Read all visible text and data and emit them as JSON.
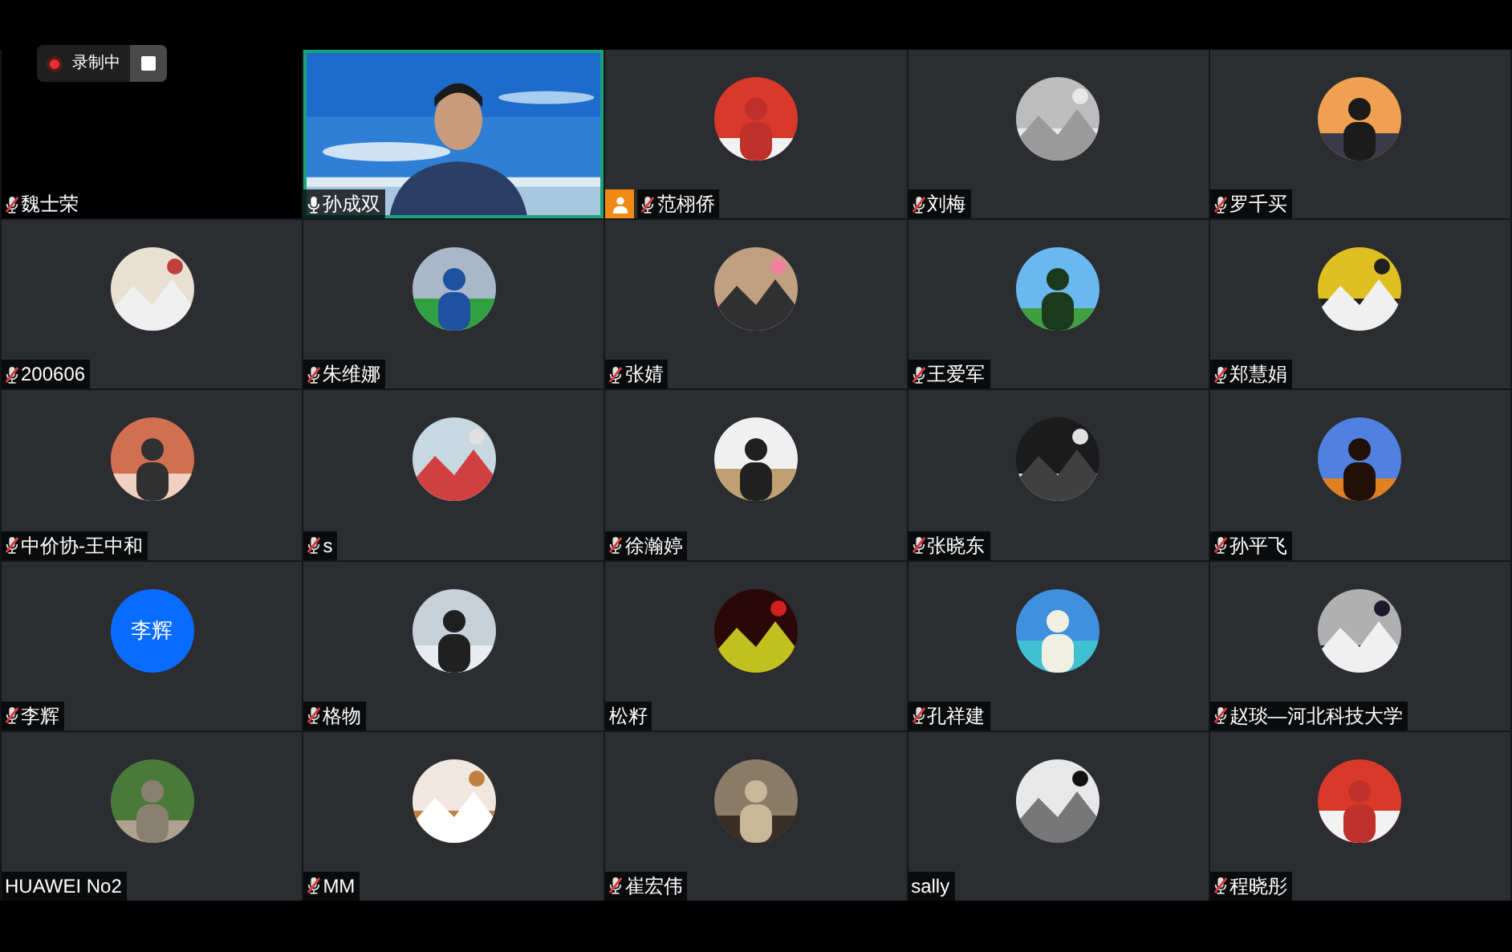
{
  "recording": {
    "label": "录制中"
  },
  "participants": [
    {
      "name": "魏士荣",
      "kind": "blank",
      "mic": {
        "muted": true
      },
      "speaking": false,
      "host": false
    },
    {
      "name": "孙成双",
      "kind": "video",
      "mic": {
        "muted": false
      },
      "speaking": true,
      "host": false
    },
    {
      "name": "范栩侨",
      "kind": "picture",
      "mic": {
        "muted": true
      },
      "speaking": false,
      "host": true
    },
    {
      "name": "刘梅",
      "kind": "picture",
      "mic": {
        "muted": true
      },
      "speaking": false,
      "host": false
    },
    {
      "name": "罗千买",
      "kind": "picture",
      "mic": {
        "muted": true
      },
      "speaking": false,
      "host": false
    },
    {
      "name": "200606",
      "kind": "picture",
      "mic": {
        "muted": true
      },
      "speaking": false,
      "host": false
    },
    {
      "name": "朱维娜",
      "kind": "picture",
      "mic": {
        "muted": true
      },
      "speaking": false,
      "host": false
    },
    {
      "name": "张婧",
      "kind": "picture",
      "mic": {
        "muted": true
      },
      "speaking": false,
      "host": false
    },
    {
      "name": "王爱军",
      "kind": "picture",
      "mic": {
        "muted": true
      },
      "speaking": false,
      "host": false
    },
    {
      "name": "郑慧娟",
      "kind": "picture",
      "mic": {
        "muted": true
      },
      "speaking": false,
      "host": false
    },
    {
      "name": "中价协-王中和",
      "kind": "picture",
      "mic": {
        "muted": true
      },
      "speaking": false,
      "host": false
    },
    {
      "name": "s",
      "kind": "picture",
      "mic": {
        "muted": true
      },
      "speaking": false,
      "host": false
    },
    {
      "name": "徐瀚婷",
      "kind": "picture",
      "mic": {
        "muted": true
      },
      "speaking": false,
      "host": false
    },
    {
      "name": "张晓东",
      "kind": "picture",
      "mic": {
        "muted": true
      },
      "speaking": false,
      "host": false
    },
    {
      "name": "孙平飞",
      "kind": "picture",
      "mic": {
        "muted": true
      },
      "speaking": false,
      "host": false
    },
    {
      "name": "李辉",
      "kind": "initials",
      "initials": "李辉",
      "color": "#0a6cff",
      "mic": {
        "muted": true
      },
      "speaking": false,
      "host": false
    },
    {
      "name": "格物",
      "kind": "picture",
      "mic": {
        "muted": true
      },
      "speaking": false,
      "host": false
    },
    {
      "name": "松籽",
      "kind": "picture",
      "speaking": false,
      "host": false
    },
    {
      "name": "孔祥建",
      "kind": "picture",
      "mic": {
        "muted": true
      },
      "speaking": false,
      "host": false
    },
    {
      "name": "赵琰—河北科技大学",
      "kind": "picture",
      "mic": {
        "muted": true
      },
      "speaking": false,
      "host": false
    },
    {
      "name": "HUAWEI No2",
      "kind": "picture",
      "speaking": false,
      "host": false
    },
    {
      "name": "MM",
      "kind": "picture",
      "mic": {
        "muted": true
      },
      "speaking": false,
      "host": false
    },
    {
      "name": "崔宏伟",
      "kind": "picture",
      "mic": {
        "muted": true
      },
      "speaking": false,
      "host": false
    },
    {
      "name": "sally",
      "kind": "picture",
      "speaking": false,
      "host": false
    },
    {
      "name": "程晓彤",
      "kind": "picture",
      "mic": {
        "muted": true
      },
      "speaking": false,
      "host": false
    }
  ]
}
